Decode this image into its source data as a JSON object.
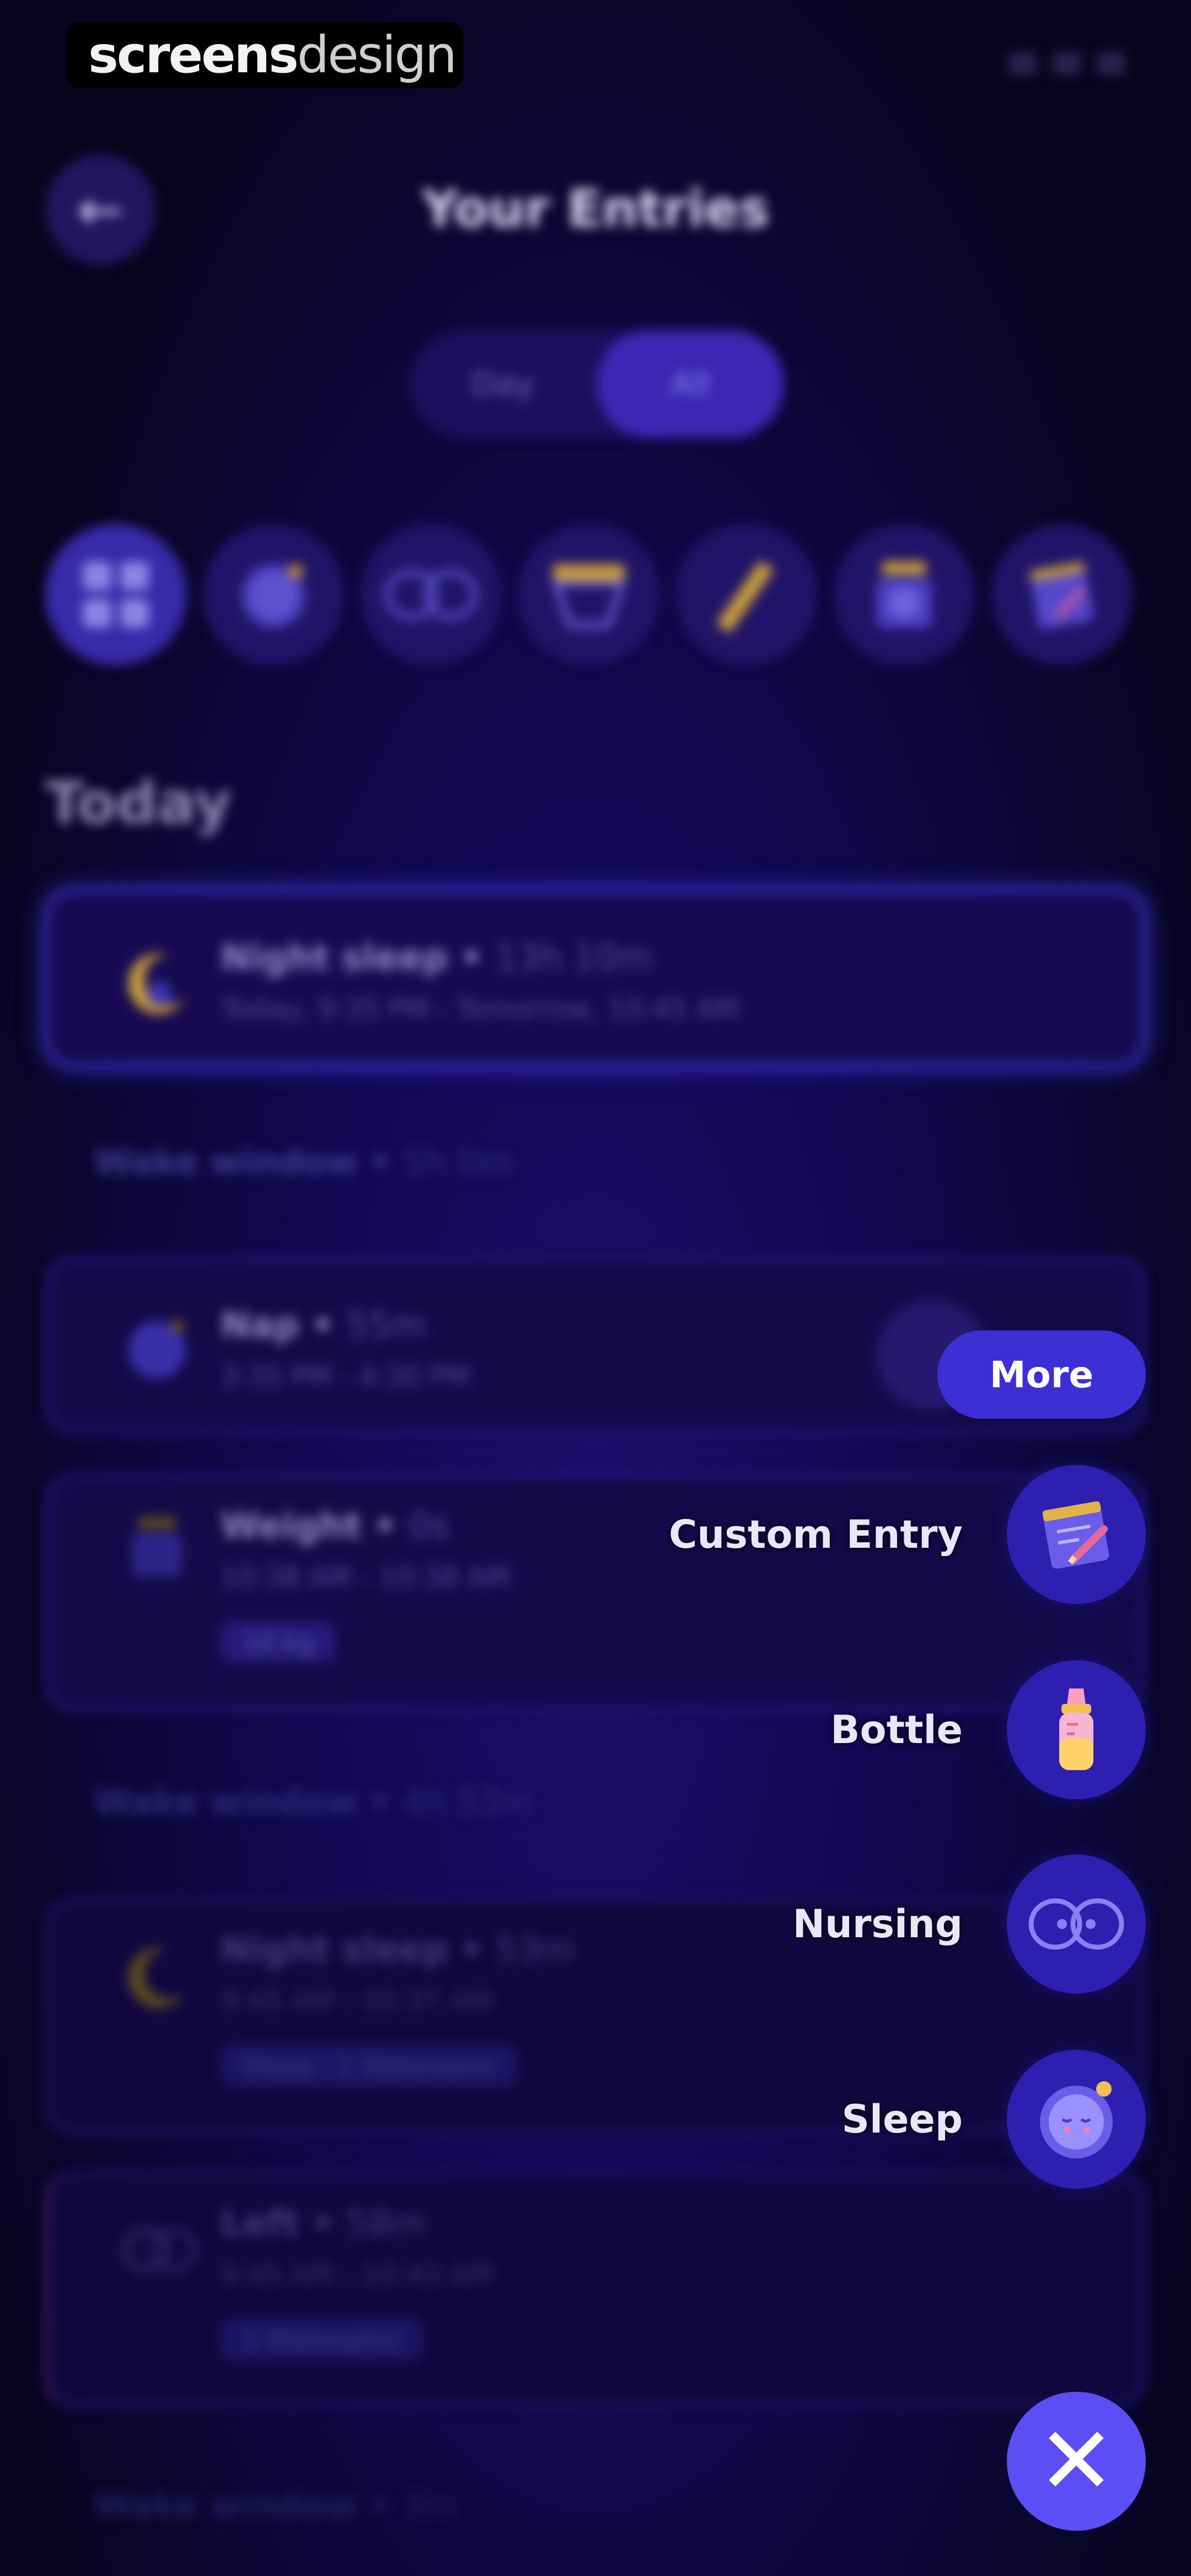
{
  "watermark": {
    "bold": "screens",
    "light": "design"
  },
  "header": {
    "title": "Your Entries"
  },
  "toggle": {
    "day": "Day",
    "all": "All"
  },
  "filters": [
    "all-icon",
    "sleep-icon",
    "nursing-icon",
    "diaper-icon",
    "ruler-icon",
    "scale-icon",
    "custom-icon"
  ],
  "section": {
    "title": "Today"
  },
  "entries": [
    {
      "title": "Night sleep",
      "duration": "13h 10m",
      "time": "Today, 9:35 PM - Tomorrow, 10:45 AM"
    },
    {
      "wake": "Wake window",
      "wake_duration": "5h 0m"
    },
    {
      "title": "Nap",
      "duration": "55m",
      "time": "3:35 PM - 4:30 PM"
    },
    {
      "title": "Weight",
      "duration": "0s",
      "time": "10:38 AM - 10:38 AM",
      "tag": "10 kg"
    },
    {
      "wake": "Wake window",
      "wake_duration": "4h 53m"
    },
    {
      "title": "Night sleep",
      "duration": "53m",
      "time": "9:45 AM - 10:37 AM",
      "tag": "Sleep · 1 Wakeup(s)"
    },
    {
      "title": "Left",
      "duration": "58m",
      "time": "9:45 AM - 10:43 AM",
      "tag": "1 Wakeup(s)"
    },
    {
      "wake": "Wake window",
      "wake_duration": "3m"
    }
  ],
  "speed_dial": {
    "more": "More",
    "items": [
      {
        "label": "Custom Entry",
        "icon": "custom-entry-icon"
      },
      {
        "label": "Bottle",
        "icon": "bottle-icon"
      },
      {
        "label": "Nursing",
        "icon": "nursing-icon"
      },
      {
        "label": "Sleep",
        "icon": "sleep-icon"
      }
    ]
  }
}
